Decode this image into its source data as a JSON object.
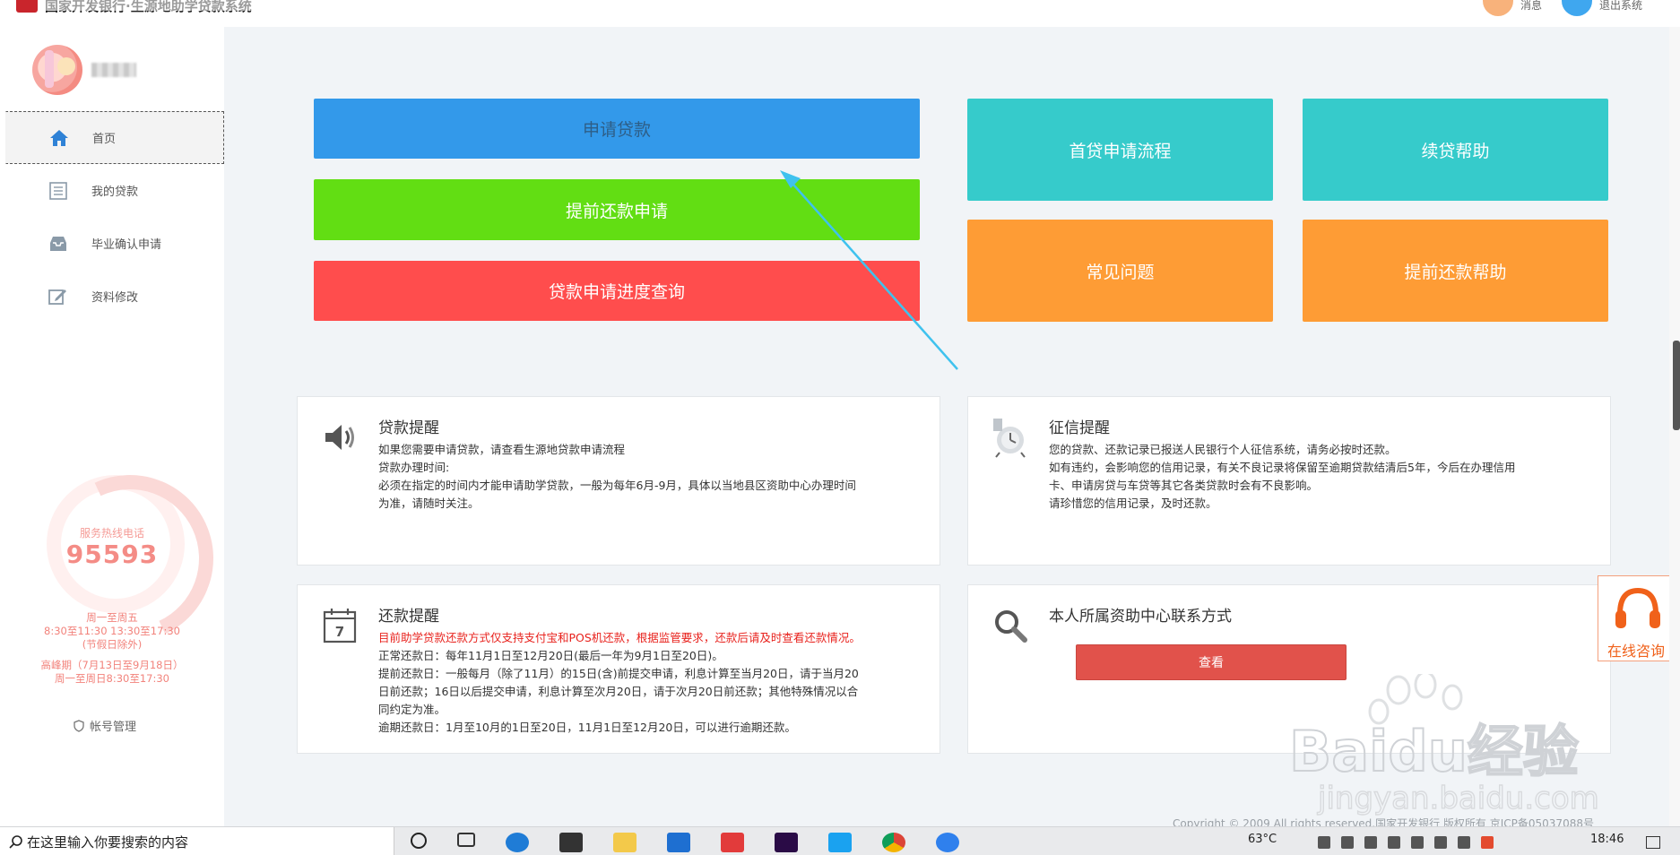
{
  "window": {
    "title": "国家开发银行·生源地助学贷款系统"
  },
  "header": {
    "messages_label": "消息",
    "logout_label": "退出系统"
  },
  "sidebar": {
    "items": [
      {
        "label": "首页",
        "icon": "home-icon",
        "active": true
      },
      {
        "label": "我的贷款",
        "icon": "list-icon"
      },
      {
        "label": "毕业确认申请",
        "icon": "inbox-icon"
      },
      {
        "label": "资料修改",
        "icon": "edit-icon"
      }
    ],
    "hotline_label": "服务热线电话",
    "hotline_number": "95593",
    "hours": [
      "周一至周五",
      "8:30至11:30 13:30至17:30",
      "(节假日除外)",
      "高峰期（7月13日至9月18日）",
      "周一至周日8:30至17:30"
    ],
    "account_label": "帐号管理"
  },
  "actions": {
    "apply_loan": "申请贷款",
    "early_repay_apply": "提前还款申请",
    "progress_query": "贷款申请进度查询",
    "first_loan_flow": "首贷申请流程",
    "renew_help": "续贷帮助",
    "faq": "常见问题",
    "early_repay_help": "提前还款帮助"
  },
  "cards": {
    "loan_reminder": {
      "title": "贷款提醒",
      "lines": [
        "如果您需要申请贷款，请查看生源地贷款申请流程",
        "贷款办理时间:",
        "必须在指定的时间内才能申请助学贷款，一般为每年6月-9月，具体以当地县区资助中心办理时间",
        "为准，请随时关注。"
      ]
    },
    "credit_reminder": {
      "title": "征信提醒",
      "lines": [
        "您的贷款、还款记录已报送人民银行个人征信系统，请务必按时还款。",
        "如有违约，会影响您的信用记录，有关不良记录将保留至逾期贷款结清后5年，今后在办理信用",
        "卡、申请房贷与车贷等其它各类贷款时会有不良影响。",
        "请珍惜您的信用记录，及时还款。"
      ]
    },
    "repay_reminder": {
      "title": "还款提醒",
      "red_line": "目前助学贷款还款方式仅支持支付宝和POS机还款，根据监管要求，还款后请及时查看还款情况。",
      "lines": [
        "正常还款日：每年11月1日至12月20日(最后一年为9月1日至20日)。",
        "提前还款日：一般每月（除了11月）的15日(含)前提交申请，利息计算至当月20日，请于当月20",
        "日前还款；16日以后提交申请，利息计算至次月20日，请于次月20日前还款；其他特殊情况以合",
        "同约定为准。",
        "逾期还款日：1月至10月的1日至20日，11月1日至12月20日，可以进行逾期还款。"
      ],
      "calendar_day": "7"
    },
    "contact": {
      "title": "本人所属资助中心联系方式",
      "view_label": "查看"
    }
  },
  "consult": {
    "label": "在线咨询"
  },
  "footer": {
    "copyright": "Copyright © 2009 All rights reserved.国家开发银行 版权所有 京ICP备05037088号"
  },
  "watermark": {
    "brand": "Baidu经验",
    "url": "jingyan.baidu.com"
  },
  "taskbar": {
    "search_placeholder": "在这里输入你要搜索的内容",
    "temperature": "63°C",
    "time": "18:46"
  },
  "colors": {
    "blue": "#3399ea",
    "green": "#62de13",
    "red": "#ff4d4d",
    "teal": "#36cbcb",
    "orange": "#fe9c35",
    "view_button": "#e1524b"
  }
}
